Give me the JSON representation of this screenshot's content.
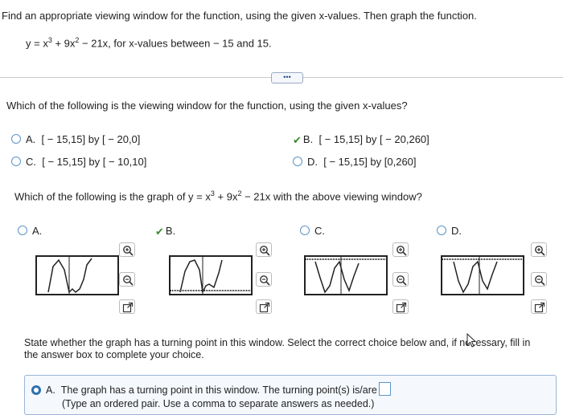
{
  "instruction": "Find an appropriate viewing window for the function, using the given x-values. Then graph the function.",
  "function_line": {
    "lhs": "y = x",
    "exp1": "3",
    "mid": " + 9x",
    "exp2": "2",
    "rhs": " − 21x, for x-values between − 15 and 15."
  },
  "more_button": "•••",
  "q1": {
    "text": "Which of the following is the viewing window for the function, using the given x-values?",
    "options": [
      {
        "letter": "A.",
        "text": "[ − 15,15] by [ − 20,0]",
        "selected": false
      },
      {
        "letter": "B.",
        "text": "[ − 15,15] by [ − 20,260]",
        "selected": true
      },
      {
        "letter": "C.",
        "text": "[ − 15,15] by [ − 10,10]",
        "selected": false
      },
      {
        "letter": "D.",
        "text": "[ − 15,15] by [0,260]",
        "selected": false
      }
    ]
  },
  "q2": {
    "text_before": "Which of the following is the graph of y = x",
    "exp1": "3",
    "text_mid": " + 9x",
    "exp2": "2",
    "text_after": " − 21x with the above viewing window?",
    "options": [
      {
        "letter": "A.",
        "selected": false
      },
      {
        "letter": "B.",
        "selected": true
      },
      {
        "letter": "C.",
        "selected": false
      },
      {
        "letter": "D.",
        "selected": false
      }
    ]
  },
  "q3": {
    "line1": "State whether the graph has a turning point in this window. Select the correct choice below and, if necessary, fill in",
    "line2": "the answer box to complete your choice."
  },
  "answer_a": {
    "letter": "A.",
    "text": "The graph has a turning point in this window. The turning point(s) is/are",
    "hint": "(Type an ordered pair. Use a comma to separate answers as needed.)"
  },
  "icons": {
    "zoom_in": "zoom-in-icon",
    "zoom_out": "zoom-out-icon",
    "popout": "popout-icon"
  },
  "colors": {
    "radio_border": "#5b93c9",
    "check_green": "#3a8a2e",
    "selected_radio": "#2f6fb0"
  }
}
